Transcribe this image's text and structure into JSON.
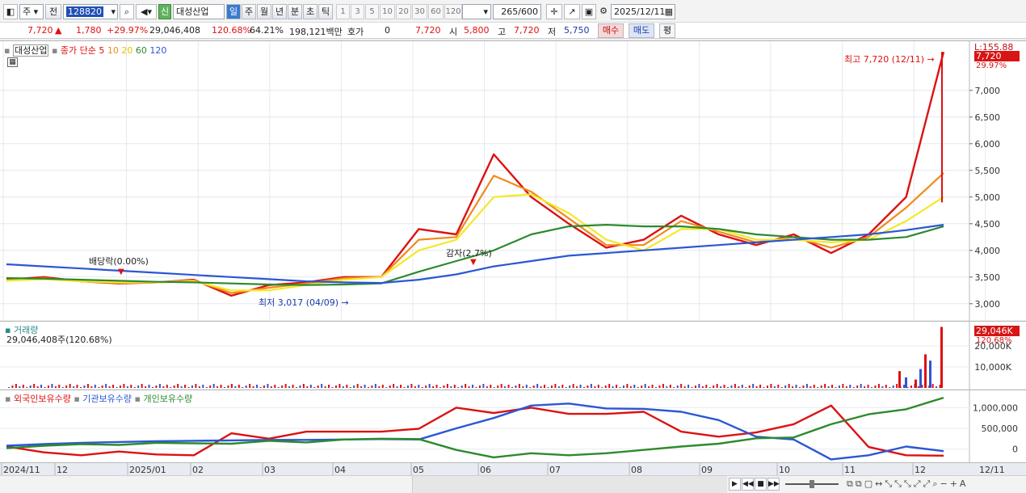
{
  "toolbar": {
    "market_sel": "주",
    "prev_label": "전",
    "code": "128820",
    "badge_new": "신",
    "stock_name": "대성산업",
    "periods": [
      "일",
      "주",
      "월",
      "년",
      "분",
      "초",
      "틱"
    ],
    "active_period": "일",
    "ticks": [
      "1",
      "3",
      "5",
      "10",
      "20",
      "30",
      "60",
      "120"
    ],
    "count": "265",
    "count_total": "/600",
    "date": "2025/12/11"
  },
  "quote": {
    "price": "7,720",
    "change": "1,780",
    "change_pct": "+29.97%",
    "volume": "29,046,408",
    "vol_ratio": "120.68%",
    "turnover": "64.21%",
    "amount": "198,121백만",
    "hoga_label": "호가",
    "hoga_value": "0",
    "hoga_price": "7,720",
    "open_label": "시",
    "open": "5,800",
    "high_label": "고",
    "high": "7,720",
    "low_label": "저",
    "low": "5,750",
    "buy": "매수",
    "sell": "매도",
    "eval": "평"
  },
  "price_panel": {
    "legend_name": "대성산업",
    "legend_ma": "종가 단순",
    "ma_periods": [
      "5",
      "10",
      "20",
      "60",
      "120"
    ],
    "ma_colors": [
      "#dd1111",
      "#f08a1c",
      "#f3e82a",
      "#2d8a2d",
      "#2b57d4"
    ],
    "axis_top": "L:155.88",
    "last_price_tag": "7,720",
    "last_pct_tag": "29.97%",
    "annot_high": "최고 7,720 (12/11)",
    "annot_low": "최저 3,017 (04/09)",
    "annot_dividend": "배당락(0.00%)",
    "annot_reduction": "감자(2.7%)"
  },
  "volume_panel": {
    "title": "거래량",
    "value": "29,046,408주(120.68%)",
    "tag": "29,046K",
    "tag_pct": "120.68%"
  },
  "holdings_panel": {
    "series_foreign": "외국인보유수량",
    "series_inst": "기관보유수량",
    "series_indiv": "개인보유수량",
    "colors": [
      "#dd1111",
      "#2b57d4",
      "#2d8a2d"
    ]
  },
  "chart_data": [
    {
      "type": "line",
      "title": "대성산업",
      "x": [
        "2024/11",
        "12",
        "2025/01",
        "02",
        "03",
        "04",
        "05",
        "06",
        "07",
        "08",
        "09",
        "10",
        "11",
        "12",
        "12/11"
      ],
      "yticks": [
        "3,000",
        "3,500",
        "4,000",
        "4,500",
        "5,000",
        "5,500",
        "6,000",
        "6,500",
        "7,000"
      ],
      "ylim": [
        2800,
        7800
      ],
      "series": [
        {
          "name": "5",
          "values": [
            3450,
            3500,
            3420,
            3380,
            3400,
            3450,
            3150,
            3350,
            3400,
            3500,
            3500,
            4400,
            4300,
            5800,
            5000,
            4500,
            4050,
            4200,
            4650,
            4300,
            4100,
            4300,
            3950,
            4300,
            5000,
            7720
          ]
        },
        {
          "name": "10",
          "values": [
            3440,
            3480,
            3420,
            3390,
            3400,
            3440,
            3200,
            3300,
            3380,
            3480,
            3500,
            4200,
            4250,
            5400,
            5100,
            4600,
            4100,
            4100,
            4550,
            4350,
            4150,
            4250,
            4050,
            4250,
            4800,
            5450
          ]
        },
        {
          "name": "20",
          "values": [
            3430,
            3460,
            3420,
            3400,
            3400,
            3420,
            3250,
            3250,
            3350,
            3450,
            3500,
            4000,
            4200,
            5000,
            5050,
            4700,
            4200,
            4000,
            4400,
            4400,
            4200,
            4200,
            4150,
            4200,
            4550,
            5000
          ]
        },
        {
          "name": "60",
          "values": [
            3480,
            3470,
            3450,
            3430,
            3410,
            3400,
            3380,
            3360,
            3350,
            3360,
            3380,
            3600,
            3800,
            4000,
            4300,
            4450,
            4480,
            4450,
            4450,
            4400,
            4300,
            4250,
            4200,
            4200,
            4250,
            4450
          ]
        },
        {
          "name": "120",
          "values": [
            3740,
            3700,
            3660,
            3620,
            3580,
            3540,
            3500,
            3460,
            3420,
            3400,
            3390,
            3450,
            3550,
            3700,
            3800,
            3900,
            3950,
            4000,
            4050,
            4100,
            4150,
            4200,
            4250,
            4300,
            4380,
            4480
          ]
        }
      ]
    },
    {
      "type": "bar",
      "title": "거래량",
      "yticks": [
        "10,000K",
        "20,000K"
      ],
      "ylim": [
        0,
        30000
      ]
    },
    {
      "type": "line",
      "title": "외국인보유수량 · 기관보유수량 · 개인보유수량",
      "yticks": [
        "0",
        "500,000",
        "1,000,000"
      ],
      "ylim": [
        -300000,
        1300000
      ],
      "series": [
        {
          "name": "외국인보유수량",
          "values": [
            60000,
            -80000,
            -150000,
            -60000,
            -130000,
            -150000,
            380000,
            250000,
            420000,
            420000,
            420000,
            490000,
            1000000,
            870000,
            1000000,
            850000,
            850000,
            900000,
            420000,
            300000,
            400000,
            600000,
            1050000,
            50000,
            -150000,
            -160000
          ]
        },
        {
          "name": "기관보유수량",
          "values": [
            80000,
            120000,
            150000,
            170000,
            190000,
            200000,
            210000,
            220000,
            220000,
            230000,
            240000,
            230000,
            500000,
            750000,
            1050000,
            1100000,
            980000,
            970000,
            900000,
            700000,
            300000,
            230000,
            -250000,
            -150000,
            60000,
            -50000
          ]
        },
        {
          "name": "개인보유수량",
          "values": [
            20000,
            80000,
            120000,
            100000,
            150000,
            140000,
            130000,
            200000,
            160000,
            230000,
            250000,
            240000,
            -20000,
            -200000,
            -100000,
            -150000,
            -100000,
            -20000,
            60000,
            130000,
            260000,
            280000,
            600000,
            840000,
            960000,
            1240000
          ]
        }
      ]
    }
  ],
  "bottom_axis": {
    "labels": [
      "2024/11",
      "12",
      "2025/01",
      "02",
      "03",
      "04",
      "05",
      "06",
      "07",
      "08",
      "09",
      "10",
      "11",
      "12"
    ],
    "right_label": "12/11"
  }
}
